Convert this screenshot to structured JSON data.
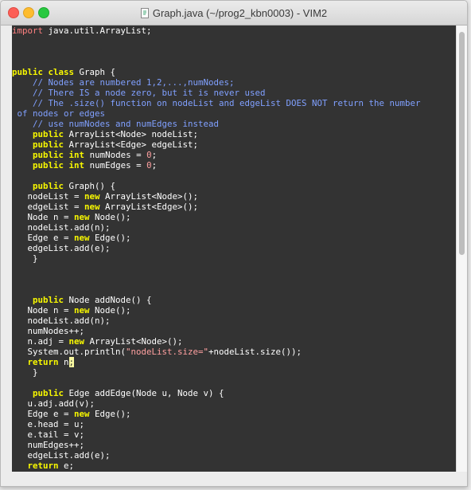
{
  "window": {
    "title": "Graph.java (~/prog2_kbn0003) - VIM2",
    "icons": {
      "close": "close-icon",
      "minimize": "minimize-icon",
      "maximize": "maximize-icon",
      "file": "java-file-icon"
    }
  },
  "editor": {
    "lines": [
      "import java.util.ArrayList;",
      "",
      "",
      "",
      "public class Graph {",
      "    // Nodes are numbered 1,2,...,numNodes;",
      "    // There IS a node zero, but it is never used",
      "    // The .size() function on nodeList and edgeList DOES NOT return the number",
      " of nodes or edges",
      "    // use numNodes and numEdges instead",
      "    public ArrayList<Node> nodeList;",
      "    public ArrayList<Edge> edgeList;",
      "    public int numNodes = 0;",
      "    public int numEdges = 0;",
      "",
      "    public Graph() {",
      "   nodeList = new ArrayList<Node>();",
      "   edgeList = new ArrayList<Edge>();",
      "   Node n = new Node();",
      "   nodeList.add(n);",
      "   Edge e = new Edge();",
      "   edgeList.add(e);",
      "    }",
      "",
      "",
      "",
      "    public Node addNode() {",
      "   Node n = new Node();",
      "   nodeList.add(n);",
      "   numNodes++;",
      "   n.adj = new ArrayList<Node>();",
      "   System.out.println(\"nodeList.size=\"+nodeList.size());",
      "   return n;",
      "    }",
      "",
      "    public Edge addEdge(Node u, Node v) {",
      "   u.adj.add(v);",
      "   Edge e = new Edge();",
      "   e.head = u;",
      "   e.tail = v;",
      "   numEdges++;",
      "   edgeList.add(e);",
      "   return e;",
      "    }"
    ]
  },
  "colors": {
    "background": "#333333",
    "text": "#ffffff",
    "keyword": "#f8f800",
    "comment": "#80a0ff",
    "import": "#ff8080",
    "number": "#ffa0a0",
    "string": "#ffa0a0"
  }
}
